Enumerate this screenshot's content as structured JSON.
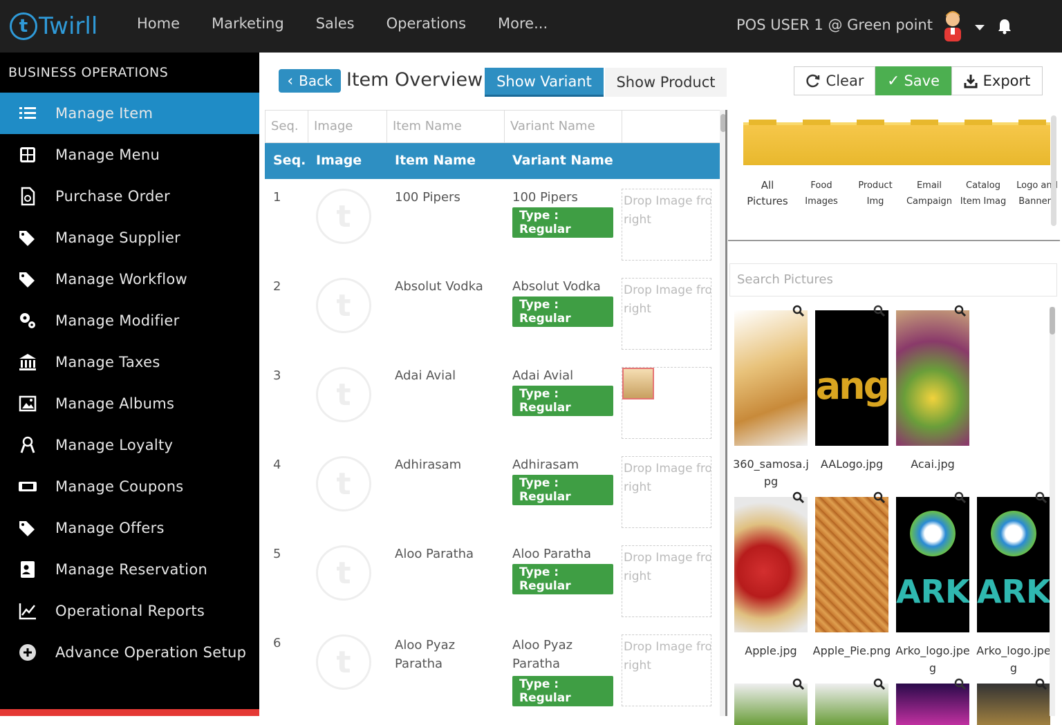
{
  "brand": {
    "name": "Twirll",
    "accent": "#2f9ad8"
  },
  "topnav": {
    "items": [
      "Home",
      "Marketing",
      "Sales",
      "Operations",
      "More..."
    ]
  },
  "user": {
    "label": "POS USER 1 @ Green point"
  },
  "sidebar": {
    "title": "BUSINESS OPERATIONS",
    "items": [
      {
        "label": "Manage Item",
        "icon": "list-icon",
        "active": true
      },
      {
        "label": "Manage Menu",
        "icon": "grid-icon"
      },
      {
        "label": "Purchase Order",
        "icon": "file-icon"
      },
      {
        "label": "Manage Supplier",
        "icon": "tags-icon"
      },
      {
        "label": "Manage Workflow",
        "icon": "tags-icon"
      },
      {
        "label": "Manage Modifier",
        "icon": "cogs-icon"
      },
      {
        "label": "Manage Taxes",
        "icon": "bank-icon"
      },
      {
        "label": "Manage Albums",
        "icon": "image-icon"
      },
      {
        "label": "Manage Loyalty",
        "icon": "award-icon"
      },
      {
        "label": "Manage Coupons",
        "icon": "ticket-icon"
      },
      {
        "label": "Manage Offers",
        "icon": "tags-icon"
      },
      {
        "label": "Manage Reservation",
        "icon": "contact-icon"
      },
      {
        "label": "Operational Reports",
        "icon": "chart-icon"
      },
      {
        "label": "Advance Operation Setup",
        "icon": "plus-circle-icon"
      }
    ]
  },
  "toolbar": {
    "back": "Back",
    "title": "Item Overview",
    "tab_variant": "Show Variant",
    "tab_product": "Show Product",
    "clear": "Clear",
    "save": "Save",
    "export": "Export"
  },
  "grid": {
    "filters": [
      "Seq.",
      "Image",
      "Item Name",
      "Variant Name"
    ],
    "headers": [
      "Seq.",
      "Image",
      "Item Name",
      "Variant Name"
    ],
    "drop_text": "Drop Image from right",
    "drop_line1": "Drop Image fro",
    "drop_line2": "right",
    "type_badge": "Type : Regular",
    "rows": [
      {
        "seq": "1",
        "item": "100 Pipers",
        "variant": "100 Pipers",
        "has_image": false
      },
      {
        "seq": "2",
        "item": "Absolut Vodka",
        "variant": "Absolut Vodka",
        "has_image": false
      },
      {
        "seq": "3",
        "item": "Adai Avial",
        "variant": "Adai Avial",
        "has_image": true
      },
      {
        "seq": "4",
        "item": "Adhirasam",
        "variant": "Adhirasam",
        "has_image": false
      },
      {
        "seq": "5",
        "item": "Aloo Paratha",
        "variant": "Aloo Paratha",
        "has_image": false
      },
      {
        "seq": "6",
        "item": "Aloo Pyaz Paratha",
        "variant": "Aloo Pyaz Paratha",
        "has_image": false
      }
    ]
  },
  "pictures": {
    "folders": [
      "All Pictures",
      "Food Images",
      "Product Img",
      "Email Campaign",
      "Catalog Item Imag",
      "Logo and Banners"
    ],
    "search_placeholder": "Search Pictures",
    "items": [
      {
        "name": "360_samosa.jpg"
      },
      {
        "name": "AALogo.jpg"
      },
      {
        "name": "Acai.jpg"
      },
      {
        "name": "Apple.jpg"
      },
      {
        "name": "Apple_Pie.png"
      },
      {
        "name": "Arko_logo.jpeg"
      },
      {
        "name": "Arko_logo.jpeg"
      }
    ]
  }
}
